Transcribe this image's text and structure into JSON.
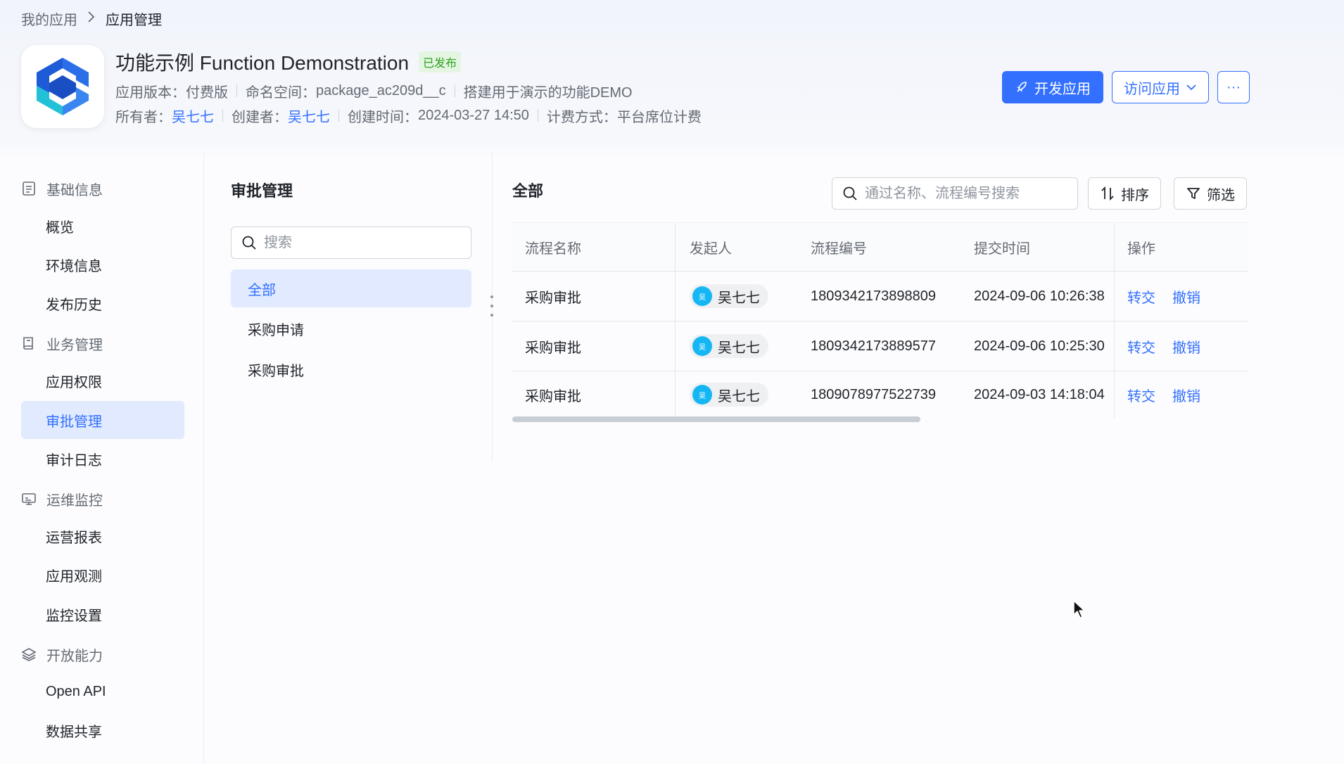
{
  "breadcrumb": {
    "root": "我的应用",
    "current": "应用管理"
  },
  "app": {
    "title": "功能示例 Function Demonstration",
    "status_badge": "已发布",
    "version_label": "应用版本：",
    "version_value": "付费版",
    "namespace_label": "命名空间：",
    "namespace_value": "package_ac209d__c",
    "description": "搭建用于演示的功能DEMO",
    "owner_label": "所有者：",
    "owner_value": "吴七七",
    "creator_label": "创建者：",
    "creator_value": "吴七七",
    "created_label": "创建时间：",
    "created_value": "2024-03-27 14:50",
    "billing_label": "计费方式：",
    "billing_value": "平台席位计费"
  },
  "actions": {
    "develop": "开发应用",
    "visit": "访问应用",
    "more": "···"
  },
  "sidebar": {
    "groups": [
      {
        "label": "基础信息",
        "icon": "doc-icon"
      },
      {
        "label": "业务管理",
        "icon": "book-icon"
      },
      {
        "label": "运维监控",
        "icon": "monitor-icon"
      },
      {
        "label": "开放能力",
        "icon": "layers-icon"
      }
    ],
    "items": {
      "overview": "概览",
      "env": "环境信息",
      "history": "发布历史",
      "permissions": "应用权限",
      "approval": "审批管理",
      "audit": "审计日志",
      "reports": "运营报表",
      "observe": "应用观测",
      "monitor_settings": "监控设置",
      "open_api": "Open API",
      "data_share": "数据共享"
    }
  },
  "middle": {
    "title": "审批管理",
    "search_placeholder": "搜索",
    "categories": [
      "全部",
      "采购申请",
      "采购审批"
    ]
  },
  "content": {
    "title": "全部",
    "search_placeholder": "通过名称、流程编号搜索",
    "sort_label": "排序",
    "filter_label": "筛选",
    "columns": [
      "流程名称",
      "发起人",
      "流程编号",
      "提交时间",
      "操作"
    ],
    "rows": [
      {
        "name": "采购审批",
        "initiator": "吴七七",
        "avatar": "吴",
        "id": "1809342173898809",
        "time": "2024-09-06 10:26:38",
        "transfer": "转交",
        "revoke": "撤销"
      },
      {
        "name": "采购审批",
        "initiator": "吴七七",
        "avatar": "吴",
        "id": "1809342173889577",
        "time": "2024-09-06 10:25:30",
        "transfer": "转交",
        "revoke": "撤销"
      },
      {
        "name": "采购审批",
        "initiator": "吴七七",
        "avatar": "吴",
        "id": "1809078977522739",
        "time": "2024-09-03 14:18:04",
        "transfer": "转交",
        "revoke": "撤销"
      }
    ]
  },
  "colors": {
    "accent": "#3370ff",
    "badge_green": "#2ea121",
    "avatar": "#14b7f4"
  }
}
